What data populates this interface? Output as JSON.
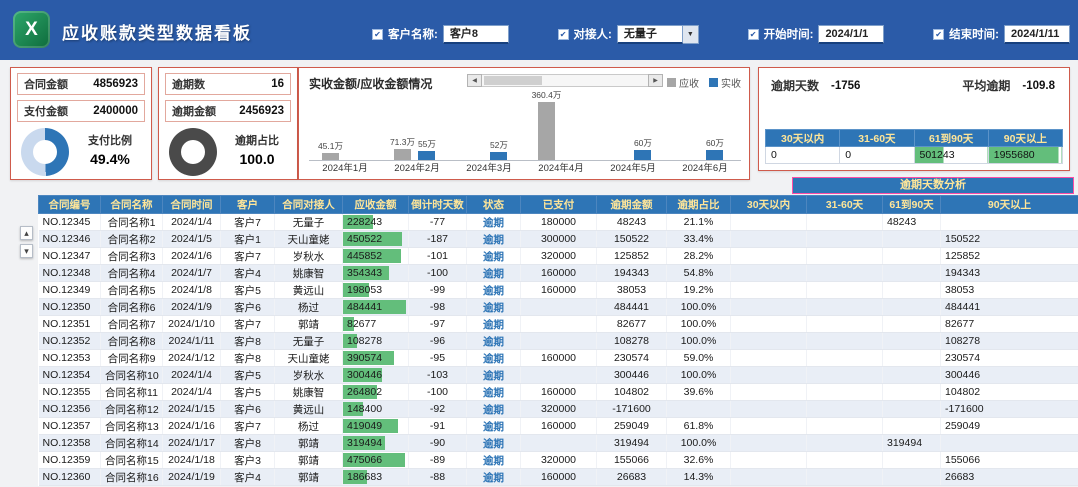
{
  "header": {
    "title": "应收账款类型数据看板",
    "filters": [
      {
        "label": "客户名称:",
        "value": "客户8",
        "type": "input"
      },
      {
        "label": "对接人:",
        "value": "无量子",
        "type": "select"
      },
      {
        "label": "开始时间:",
        "value": "2024/1/1",
        "type": "input"
      },
      {
        "label": "结束时间:",
        "value": "2024/1/11",
        "type": "input"
      }
    ]
  },
  "cards": {
    "payment": {
      "stats": [
        {
          "label": "合同金额",
          "value": "4856923"
        },
        {
          "label": "支付金额",
          "value": "2400000"
        }
      ],
      "donut_label": "支付比例",
      "donut_value": "49.4%",
      "percent": 49.4,
      "color": "#2e75b6",
      "track": "#c9d9ee"
    },
    "overdue": {
      "stats": [
        {
          "label": "逾期数",
          "value": "16"
        },
        {
          "label": "逾期金额",
          "value": "2456923"
        }
      ],
      "donut_label": "逾期占比",
      "donut_value": "100.0",
      "percent": 100,
      "color": "#4a4a4a",
      "track": "#d9d9d9"
    }
  },
  "chart_data": {
    "type": "bar",
    "title": "实收金额/应收金额情况",
    "categories": [
      "2024年1月",
      "2024年2月",
      "2024年3月",
      "2024年4月",
      "2024年5月",
      "2024年6月"
    ],
    "series": [
      {
        "name": "应收",
        "color": "#a6a6a6",
        "values": [
          45.1,
          71.3,
          null,
          360.4,
          null,
          null
        ]
      },
      {
        "name": "实收",
        "color": "#2e75b6",
        "values": [
          null,
          55.0,
          52.0,
          null,
          60.0,
          60.0
        ]
      }
    ],
    "unit": "万",
    "ymax": 360.4,
    "legend_position": "top-right"
  },
  "overdue_summary": {
    "days_label": "逾期天数",
    "days_value": "-1756",
    "avg_label": "平均逾期",
    "avg_value": "-109.8",
    "columns": [
      "30天以内",
      "31-60天",
      "61到90天",
      "90天以上"
    ],
    "values": [
      "0",
      "0",
      "501243",
      "1955680"
    ],
    "bar_percent": [
      0,
      0,
      40,
      96
    ]
  },
  "analysis_banner": "逾期天数分析",
  "table": {
    "max_receivable": 500000,
    "columns": [
      "合同编号",
      "合同名称",
      "合同时间",
      "客户",
      "合同对接人",
      "应收金额",
      "倒计时天数",
      "状态",
      "已支付",
      "逾期金额",
      "逾期占比",
      "30天以内",
      "31-60天",
      "61到90天",
      "90天以上"
    ],
    "rows": [
      [
        "NO.12345",
        "合同名称1",
        "2024/1/4",
        "客户7",
        "无量子",
        "228243",
        "-77",
        "逾期",
        "180000",
        "48243",
        "21.1%",
        "",
        "",
        "48243",
        ""
      ],
      [
        "NO.12346",
        "合同名称2",
        "2024/1/5",
        "客户1",
        "天山童姥",
        "450522",
        "-187",
        "逾期",
        "300000",
        "150522",
        "33.4%",
        "",
        "",
        "",
        "150522"
      ],
      [
        "NO.12347",
        "合同名称3",
        "2024/1/6",
        "客户7",
        "岁秋水",
        "445852",
        "-101",
        "逾期",
        "320000",
        "125852",
        "28.2%",
        "",
        "",
        "",
        "125852"
      ],
      [
        "NO.12348",
        "合同名称4",
        "2024/1/7",
        "客户4",
        "姚康智",
        "354343",
        "-100",
        "逾期",
        "160000",
        "194343",
        "54.8%",
        "",
        "",
        "",
        "194343"
      ],
      [
        "NO.12349",
        "合同名称5",
        "2024/1/8",
        "客户5",
        "黄远山",
        "198053",
        "-99",
        "逾期",
        "160000",
        "38053",
        "19.2%",
        "",
        "",
        "",
        "38053"
      ],
      [
        "NO.12350",
        "合同名称6",
        "2024/1/9",
        "客户6",
        "杨过",
        "484441",
        "-98",
        "逾期",
        "",
        "484441",
        "100.0%",
        "",
        "",
        "",
        "484441"
      ],
      [
        "NO.12351",
        "合同名称7",
        "2024/1/10",
        "客户7",
        "郭靖",
        "82677",
        "-97",
        "逾期",
        "",
        "82677",
        "100.0%",
        "",
        "",
        "",
        "82677"
      ],
      [
        "NO.12352",
        "合同名称8",
        "2024/1/11",
        "客户8",
        "无量子",
        "108278",
        "-96",
        "逾期",
        "",
        "108278",
        "100.0%",
        "",
        "",
        "",
        "108278"
      ],
      [
        "NO.12353",
        "合同名称9",
        "2024/1/12",
        "客户8",
        "天山童姥",
        "390574",
        "-95",
        "逾期",
        "160000",
        "230574",
        "59.0%",
        "",
        "",
        "",
        "230574"
      ],
      [
        "NO.12354",
        "合同名称10",
        "2024/1/4",
        "客户5",
        "岁秋水",
        "300446",
        "-103",
        "逾期",
        "",
        "300446",
        "100.0%",
        "",
        "",
        "",
        "300446"
      ],
      [
        "NO.12355",
        "合同名称11",
        "2024/1/4",
        "客户5",
        "姚康智",
        "264802",
        "-100",
        "逾期",
        "160000",
        "104802",
        "39.6%",
        "",
        "",
        "",
        "104802"
      ],
      [
        "NO.12356",
        "合同名称12",
        "2024/1/15",
        "客户6",
        "黄远山",
        "148400",
        "-92",
        "逾期",
        "320000",
        "-171600",
        "",
        "",
        "",
        "",
        "-171600"
      ],
      [
        "NO.12357",
        "合同名称13",
        "2024/1/16",
        "客户7",
        "杨过",
        "419049",
        "-91",
        "逾期",
        "160000",
        "259049",
        "61.8%",
        "",
        "",
        "",
        "259049"
      ],
      [
        "NO.12358",
        "合同名称14",
        "2024/1/17",
        "客户8",
        "郭靖",
        "319494",
        "-90",
        "逾期",
        "",
        "319494",
        "100.0%",
        "",
        "",
        "319494",
        ""
      ],
      [
        "NO.12359",
        "合同名称15",
        "2024/1/18",
        "客户3",
        "郭靖",
        "475066",
        "-89",
        "逾期",
        "320000",
        "155066",
        "32.6%",
        "",
        "",
        "",
        "155066"
      ],
      [
        "NO.12360",
        "合同名称16",
        "2024/1/19",
        "客户4",
        "郭靖",
        "186683",
        "-88",
        "逾期",
        "160000",
        "26683",
        "14.3%",
        "",
        "",
        "",
        "26683"
      ]
    ]
  }
}
